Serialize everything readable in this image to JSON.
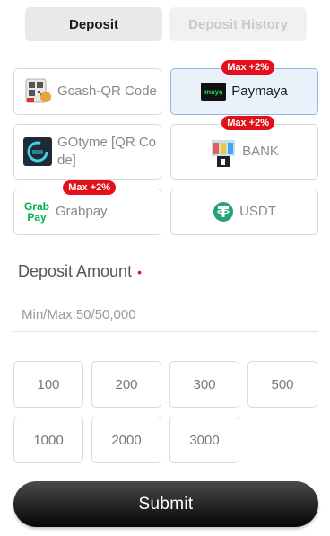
{
  "tabs": {
    "deposit": "Deposit",
    "history": "Deposit History"
  },
  "methods": [
    {
      "name": "Gcash-QR Code",
      "selected": false
    },
    {
      "name": "Paymaya",
      "selected": true,
      "badge": "Max +2%",
      "logo_text": "maya"
    },
    {
      "name": "GOtyme [QR Code]",
      "line1": "GOtyme [QR Co",
      "line2": "de]",
      "selected": false
    },
    {
      "name": "BANK",
      "selected": false,
      "badge": "Max +2%"
    },
    {
      "name": "Grabpay",
      "selected": false,
      "badge": "Max +2%",
      "logo_line1": "Grab",
      "logo_line2": "Pay"
    },
    {
      "name": "USDT",
      "selected": false
    }
  ],
  "amount": {
    "title": "Deposit Amount",
    "required_mark": "•",
    "placeholder": "Min/Max:50/50,000"
  },
  "quick_amounts": [
    "100",
    "200",
    "300",
    "500",
    "1000",
    "2000",
    "3000"
  ],
  "submit_label": "Submit",
  "colors": {
    "badge": "#e3101b",
    "selected_bg": "#e9f1fb",
    "maya_green": "#22d26a",
    "usdt": "#26a17b",
    "grab": "#00b14f"
  }
}
